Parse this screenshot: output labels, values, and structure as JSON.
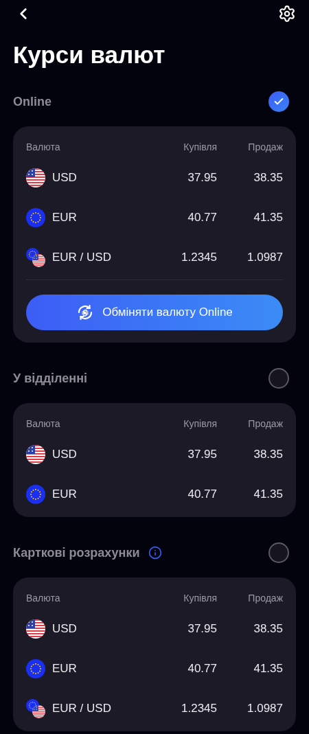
{
  "title": "Курси валют",
  "sections": [
    {
      "title": "Online",
      "selected": true,
      "info": false,
      "columns": [
        "Валюта",
        "Купівля",
        "Продаж"
      ],
      "rows": [
        {
          "kind": "usd",
          "currency": "USD",
          "buy": "37.95",
          "sell": "38.35"
        },
        {
          "kind": "eur",
          "currency": "EUR",
          "buy": "40.77",
          "sell": "41.35"
        },
        {
          "kind": "eur-usd",
          "currency": "EUR / USD",
          "buy": "1.2345",
          "sell": "1.0987"
        }
      ],
      "button": "Обміняти валюту Online"
    },
    {
      "title": "У відділенні",
      "selected": false,
      "info": false,
      "columns": [
        "Валюта",
        "Купівля",
        "Продаж"
      ],
      "rows": [
        {
          "kind": "usd",
          "currency": "USD",
          "buy": "37.95",
          "sell": "38.35"
        },
        {
          "kind": "eur",
          "currency": "EUR",
          "buy": "40.77",
          "sell": "41.35"
        }
      ]
    },
    {
      "title": "Карткові розрахунки",
      "selected": false,
      "info": true,
      "columns": [
        "Валюта",
        "Купівля",
        "Продаж"
      ],
      "rows": [
        {
          "kind": "usd",
          "currency": "USD",
          "buy": "37.95",
          "sell": "38.35"
        },
        {
          "kind": "eur",
          "currency": "EUR",
          "buy": "40.77",
          "sell": "41.35"
        },
        {
          "kind": "eur-usd",
          "currency": "EUR / USD",
          "buy": "1.2345",
          "sell": "1.0987"
        }
      ]
    }
  ]
}
